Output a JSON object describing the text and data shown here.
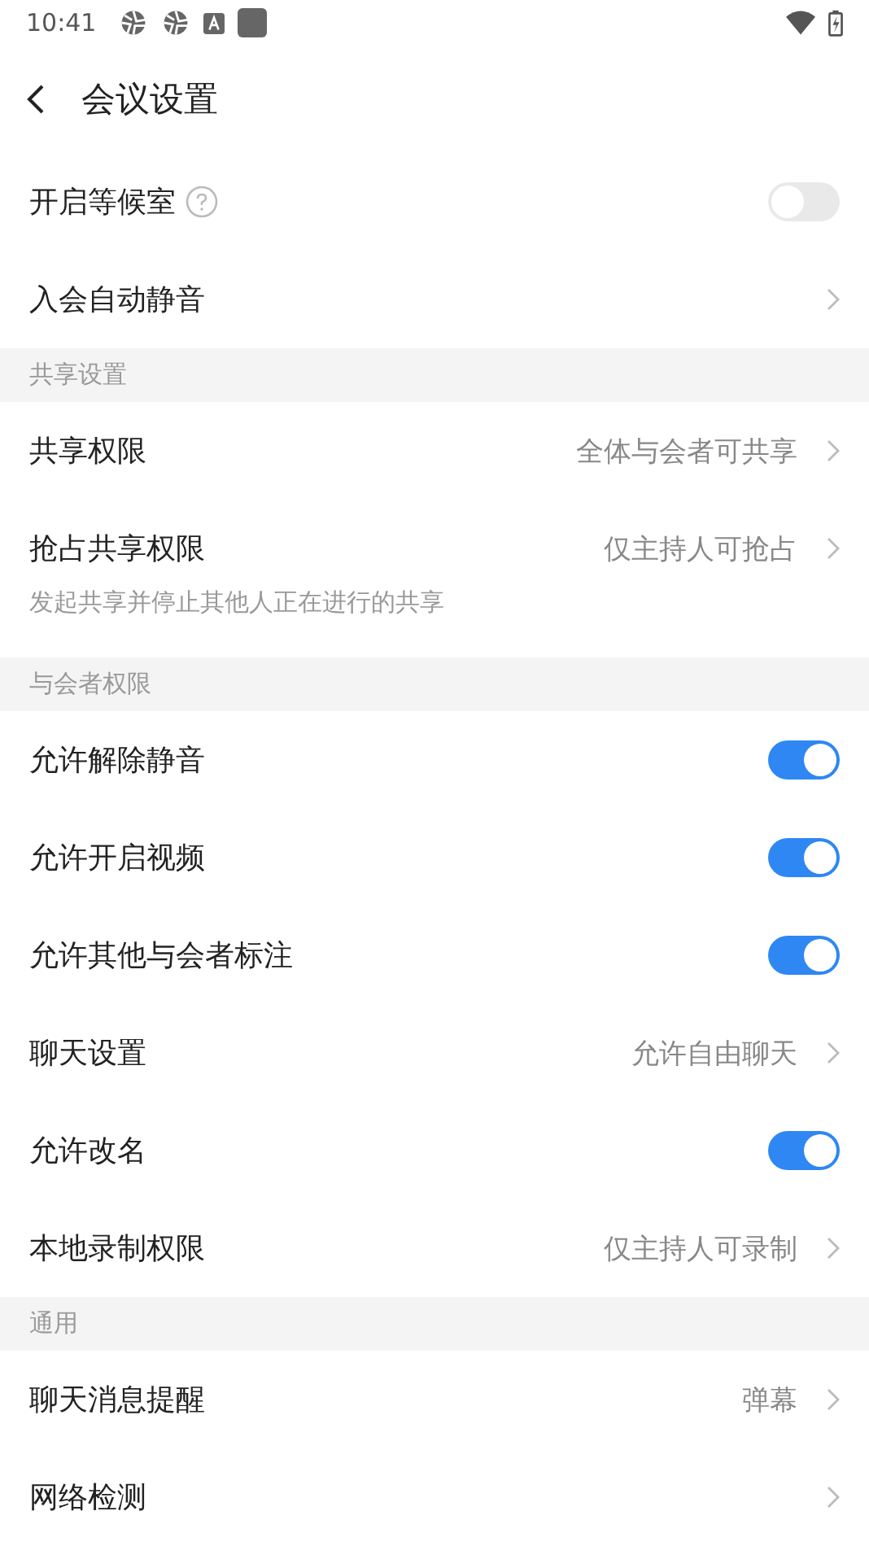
{
  "status_bar": {
    "time": "10:41"
  },
  "header": {
    "title": "会议设置"
  },
  "sections": [
    {
      "items": [
        {
          "kind": "toggle",
          "label": "开启等候室",
          "help": true,
          "on": false
        },
        {
          "kind": "link",
          "label": "入会自动静音"
        }
      ]
    },
    {
      "title": "共享设置",
      "items": [
        {
          "kind": "link",
          "label": "共享权限",
          "value": "全体与会者可共享"
        },
        {
          "kind": "link",
          "label": "抢占共享权限",
          "value": "仅主持人可抢占",
          "note": "发起共享并停止其他人正在进行的共享"
        }
      ]
    },
    {
      "title": "与会者权限",
      "items": [
        {
          "kind": "toggle",
          "label": "允许解除静音",
          "on": true
        },
        {
          "kind": "toggle",
          "label": "允许开启视频",
          "on": true
        },
        {
          "kind": "toggle",
          "label": "允许其他与会者标注",
          "on": true
        },
        {
          "kind": "link",
          "label": "聊天设置",
          "value": "允许自由聊天"
        },
        {
          "kind": "toggle",
          "label": "允许改名",
          "on": true
        },
        {
          "kind": "link",
          "label": "本地录制权限",
          "value": "仅主持人可录制"
        }
      ]
    },
    {
      "title": "通用",
      "items": [
        {
          "kind": "link",
          "label": "聊天消息提醒",
          "value": "弹幕"
        },
        {
          "kind": "link",
          "label": "网络检测"
        }
      ]
    }
  ]
}
